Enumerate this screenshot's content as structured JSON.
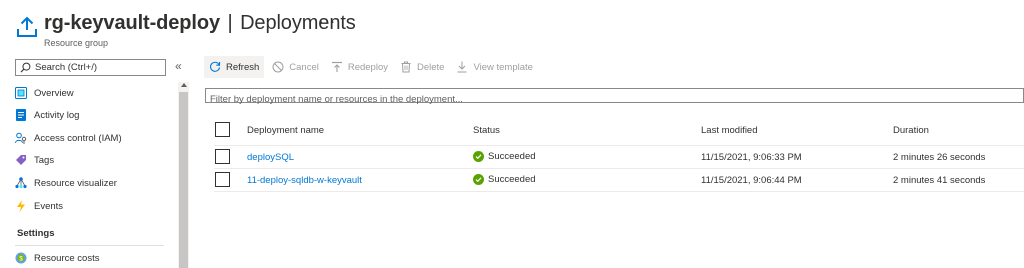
{
  "header": {
    "resource_name": "rg-keyvault-deploy",
    "separator": "|",
    "page_title": "Deployments",
    "more_label": "···",
    "subtitle": "Resource group"
  },
  "sidebar": {
    "search_placeholder": "Search (Ctrl+/)",
    "collapse_label": "«",
    "items": [
      {
        "label": "Overview",
        "icon": "overview-icon"
      },
      {
        "label": "Activity log",
        "icon": "activity-log-icon"
      },
      {
        "label": "Access control (IAM)",
        "icon": "iam-icon"
      },
      {
        "label": "Tags",
        "icon": "tag-icon"
      },
      {
        "label": "Resource visualizer",
        "icon": "visualizer-icon"
      },
      {
        "label": "Events",
        "icon": "events-icon"
      }
    ],
    "section_settings": "Settings",
    "settings_items": [
      {
        "label": "Resource costs",
        "icon": "resource-costs-icon"
      }
    ]
  },
  "toolbar": {
    "refresh": "Refresh",
    "cancel": "Cancel",
    "redeploy": "Redeploy",
    "delete": "Delete",
    "view_template": "View template"
  },
  "filter": {
    "placeholder": "Filter by deployment name or resources in the deployment..."
  },
  "table": {
    "columns": [
      "Deployment name",
      "Status",
      "Last modified",
      "Duration"
    ],
    "rows": [
      {
        "name": "deploySQL",
        "status": "Succeeded",
        "modified": "11/15/2021, 9:06:33 PM",
        "duration": "2 minutes 26 seconds"
      },
      {
        "name": "11-deploy-sqldb-w-keyvault",
        "status": "Succeeded",
        "modified": "11/15/2021, 9:06:44 PM",
        "duration": "2 minutes 41 seconds"
      }
    ]
  },
  "colors": {
    "link": "#0078d4",
    "success": "#57a300",
    "disabled": "#a19f9d"
  }
}
